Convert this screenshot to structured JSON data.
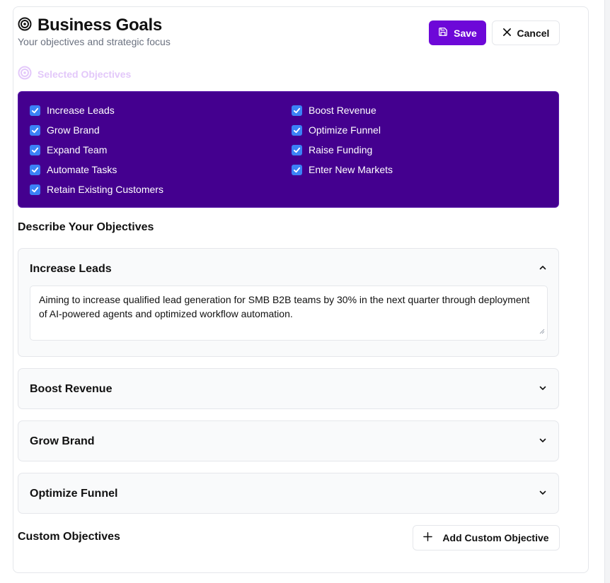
{
  "header": {
    "title": "Business Goals",
    "subtitle": "Your objectives and strategic focus",
    "save_label": "Save",
    "cancel_label": "Cancel",
    "title_icon": "target-icon"
  },
  "selected_objectives": {
    "heading": "Selected Objectives",
    "heading_icon": "target-icon",
    "items": [
      {
        "label": "Increase Leads",
        "checked": true
      },
      {
        "label": "Grow Brand",
        "checked": true
      },
      {
        "label": "Expand Team",
        "checked": true
      },
      {
        "label": "Automate Tasks",
        "checked": true
      },
      {
        "label": "Retain Existing Customers",
        "checked": true
      },
      {
        "label": "Boost Revenue",
        "checked": true
      },
      {
        "label": "Optimize Funnel",
        "checked": true
      },
      {
        "label": "Raise Funding",
        "checked": true
      },
      {
        "label": "Enter New Markets",
        "checked": true
      }
    ]
  },
  "describe": {
    "heading": "Describe Your Objectives",
    "accordions": [
      {
        "title": "Increase Leads",
        "expanded": true,
        "text": "Aiming to increase qualified lead generation for SMB B2B teams by 30% in the next quarter through deployment of AI-powered agents and optimized workflow automation."
      },
      {
        "title": "Boost Revenue",
        "expanded": false
      },
      {
        "title": "Grow Brand",
        "expanded": false
      },
      {
        "title": "Optimize Funnel",
        "expanded": false
      }
    ]
  },
  "custom": {
    "heading": "Custom Objectives",
    "add_label": "Add Custom Objective"
  },
  "colors": {
    "accent": "#6d08d8",
    "panel": "#44008f",
    "checkbox": "#3b82f6",
    "muted_heading": "#e3c8fa"
  }
}
